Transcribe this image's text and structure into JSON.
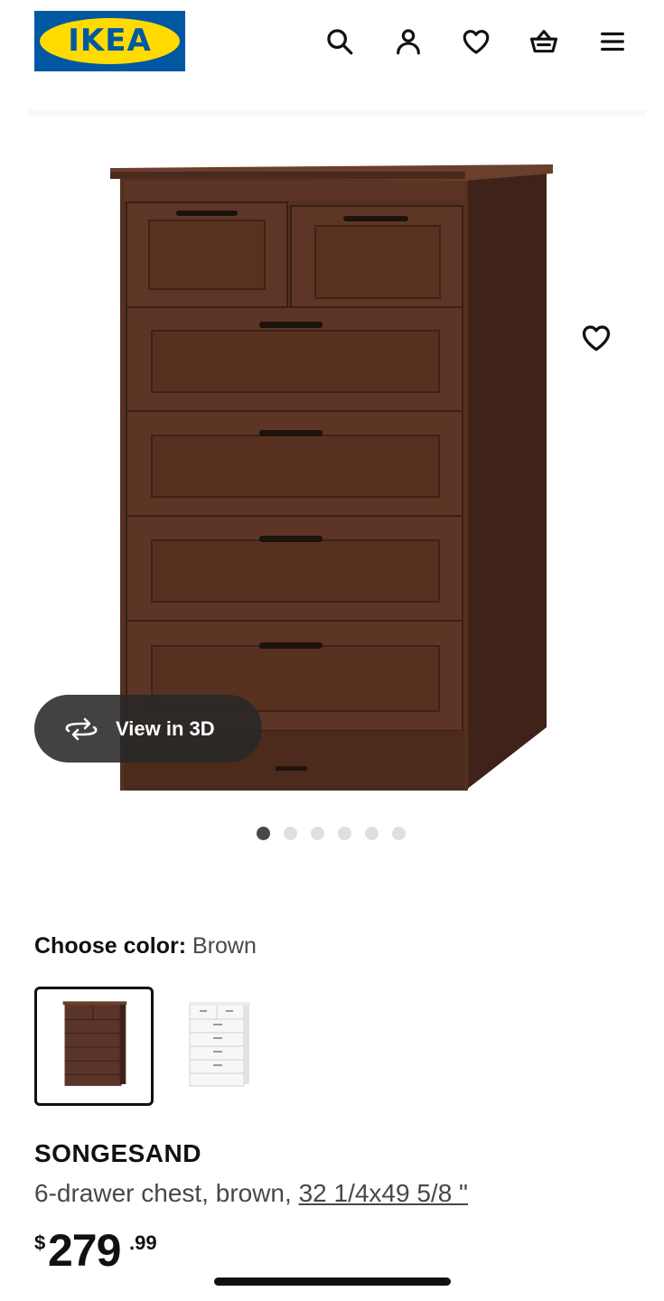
{
  "header": {
    "logo_text": "IKEA",
    "icons": [
      "search-icon",
      "user-icon",
      "heart-icon",
      "basket-icon",
      "menu-icon"
    ],
    "logo_colors": {
      "blue": "#0058a3",
      "yellow": "#ffdb00"
    }
  },
  "gallery": {
    "view_3d_label": "View in 3D",
    "image_count": 6,
    "active_image_index": 0
  },
  "color_picker": {
    "label": "Choose color:",
    "selected_value": "Brown",
    "options": [
      "brown",
      "white"
    ]
  },
  "product": {
    "name": "SONGESAND",
    "description": "6-drawer chest, brown, ",
    "dimensions": "32 1/4x49 5/8 \"",
    "price_currency": "$",
    "price_main": "279",
    "price_cents": ".99"
  },
  "colors": {
    "wood": "#5a3428",
    "wood_dark": "#3e2219",
    "text": "#111111",
    "muted_text": "#484848",
    "dot_active": "#484848",
    "dot_inactive": "#dfdfdf"
  }
}
